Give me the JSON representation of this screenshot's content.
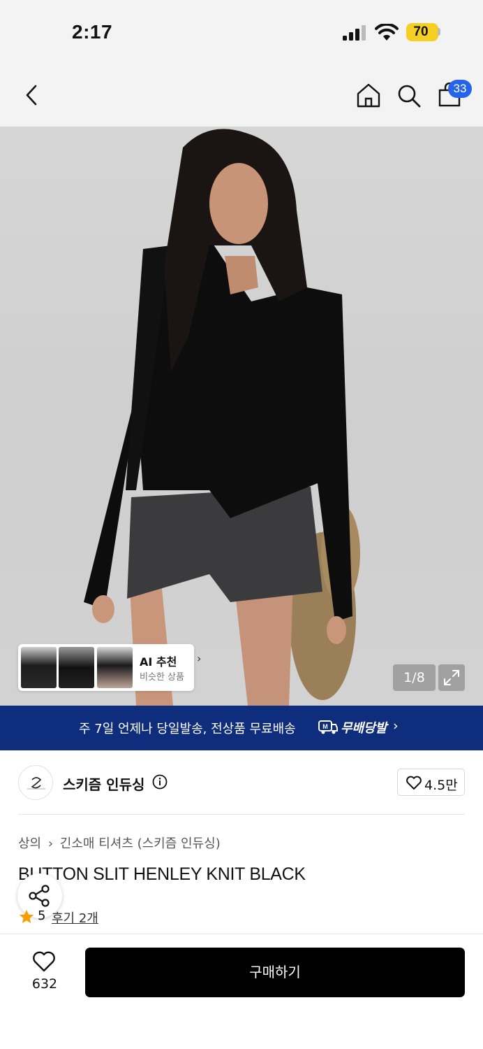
{
  "status_bar": {
    "time": "2:17",
    "battery": "70",
    "icons": [
      "signal-icon",
      "wifi-icon",
      "battery-icon"
    ]
  },
  "top_nav": {
    "icons": [
      "back-icon",
      "home-icon",
      "search-icon",
      "cart-icon"
    ],
    "cart_badge": "33"
  },
  "hero": {
    "image_counter": "1/8",
    "ai_recommend": {
      "title": "AI 추천",
      "subtitle": "비슷한 상품"
    }
  },
  "banner": {
    "text": "주 7일 언제나 당일발송, 전상품 무료배송",
    "brand": "무배당발",
    "accent_color": "#0e2d7c"
  },
  "brand": {
    "name": "스키즘 인듀싱",
    "likes": "4.5만"
  },
  "breadcrumb": [
    "상의",
    "긴소매 티셔츠 (스키즘 인듀싱)"
  ],
  "product": {
    "title": "BUTTON SLIT HENLEY KNIT BLACK",
    "rating": "5",
    "reviews": "후기 2개"
  },
  "bottom_bar": {
    "wish_count": "632",
    "buy_label": "구매하기"
  }
}
